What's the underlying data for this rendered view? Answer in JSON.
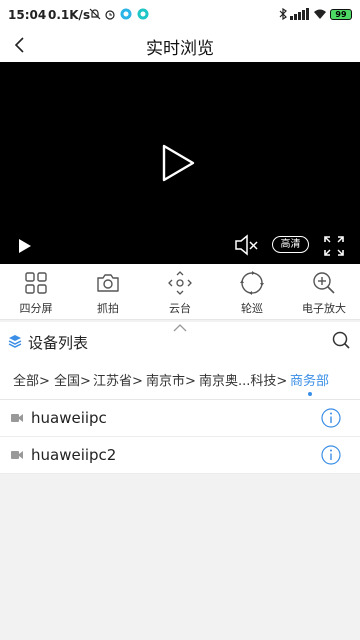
{
  "status_bar": {
    "time": "15:04",
    "network_speed": "0.1K/s",
    "battery": "99"
  },
  "header": {
    "title": "实时浏览"
  },
  "video": {
    "quality_label": "高清"
  },
  "toolbar": {
    "items": [
      {
        "label": "四分屏",
        "icon": "grid-four-icon"
      },
      {
        "label": "抓拍",
        "icon": "camera-icon"
      },
      {
        "label": "云台",
        "icon": "ptz-icon"
      },
      {
        "label": "轮巡",
        "icon": "patrol-icon"
      },
      {
        "label": "电子放大",
        "icon": "zoom-in-icon"
      }
    ]
  },
  "device_list": {
    "title": "设备列表",
    "breadcrumb": [
      "全部>",
      "全国>",
      "江苏省>",
      "南京市>",
      "南京奥...科技>",
      "商务部"
    ],
    "devices": [
      {
        "name": "huaweiipc"
      },
      {
        "name": "huaweiipc2"
      }
    ]
  },
  "colors": {
    "accent": "#3a8ee6",
    "video_bg": "#000000",
    "page_bg": "#f2f2f2"
  }
}
